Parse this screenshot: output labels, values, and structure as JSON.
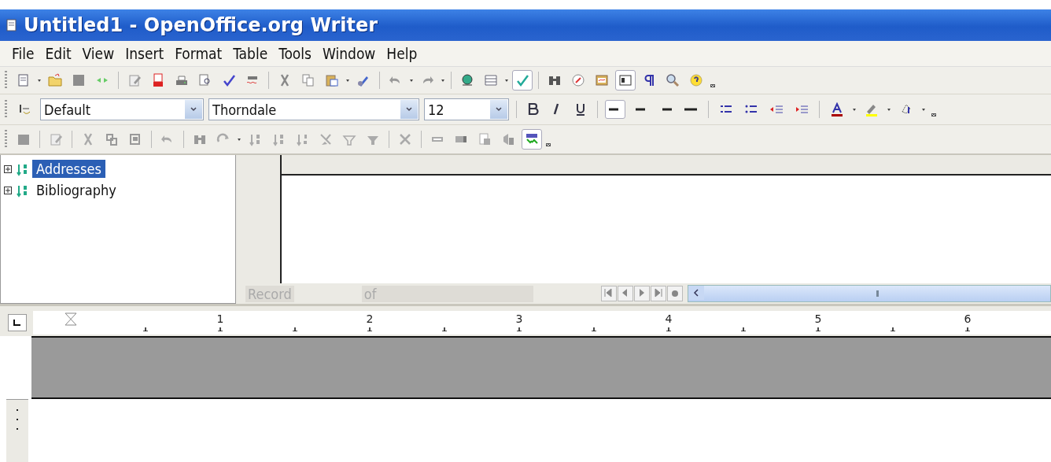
{
  "window": {
    "title": "Untitled1 - OpenOffice.org Writer"
  },
  "menu": [
    {
      "label": "File"
    },
    {
      "label": "Edit"
    },
    {
      "label": "View"
    },
    {
      "label": "Insert"
    },
    {
      "label": "Format"
    },
    {
      "label": "Table"
    },
    {
      "label": "Tools"
    },
    {
      "label": "Window"
    },
    {
      "label": "Help"
    }
  ],
  "standard_toolbar": {
    "autospellcheck_on": true,
    "navigator_on": true
  },
  "formatting_toolbar": {
    "paragraph_style": "Default",
    "font_name": "Thorndale",
    "font_size": "12",
    "alignment": [
      {
        "kind": "left",
        "selected": true
      },
      {
        "kind": "center",
        "selected": false
      },
      {
        "kind": "right",
        "selected": false
      },
      {
        "kind": "justify",
        "selected": false
      }
    ]
  },
  "table_data_bar": {
    "explorer_on": true
  },
  "data_sources": {
    "items": [
      {
        "label": "Addresses",
        "selected": true,
        "expanded": false
      },
      {
        "label": "Bibliography",
        "selected": false,
        "expanded": false
      }
    ],
    "record_label": "Record",
    "of_label": "of"
  },
  "ruler": {
    "labels": [
      "1",
      "2",
      "3",
      "4",
      "5",
      "6"
    ]
  }
}
